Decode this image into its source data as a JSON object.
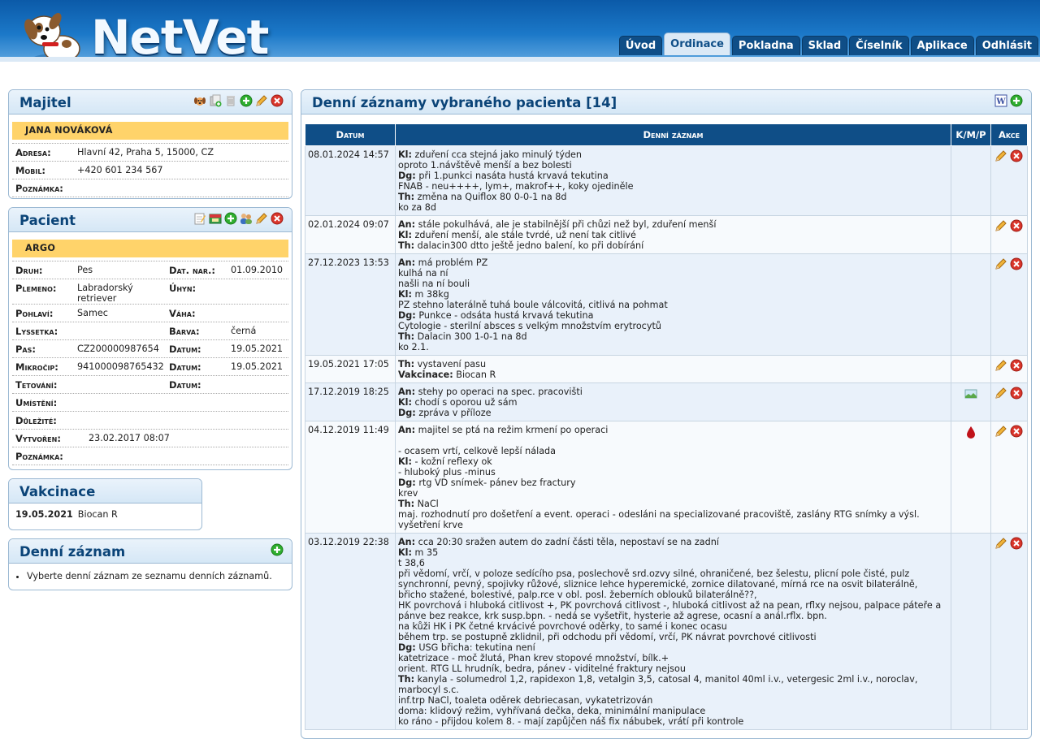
{
  "app": {
    "logo_text": "NetVet"
  },
  "tabs": [
    {
      "label": "Úvod",
      "active": false
    },
    {
      "label": "Ordinace",
      "active": true
    },
    {
      "label": "Pokladna",
      "active": false
    },
    {
      "label": "Sklad",
      "active": false
    },
    {
      "label": "Číselník",
      "active": false
    },
    {
      "label": "Aplikace",
      "active": false
    },
    {
      "label": "Odhlásit",
      "active": false
    }
  ],
  "owner": {
    "title": "Majitel",
    "name": "JANA NOVÁKOVÁ",
    "rows": [
      {
        "label": "Adresa:",
        "value": "Hlavní 42, Praha 5, 15000, CZ"
      },
      {
        "label": "Mobil:",
        "value": "+420 601 234 567"
      },
      {
        "label": "Poznámka:",
        "value": ""
      }
    ]
  },
  "patient": {
    "title": "Pacient",
    "name": "ARGO",
    "rows": [
      {
        "l1": "Druh:",
        "v1": "Pes",
        "l2": "Dat. nar.:",
        "v2": "01.09.2010"
      },
      {
        "l1": "Plemeno:",
        "v1": "Labradorský retriever",
        "l2": "Úhyn:",
        "v2": ""
      },
      {
        "l1": "Pohlaví:",
        "v1": "Samec",
        "l2": "Váha:",
        "v2": ""
      },
      {
        "l1": "Lyssetka:",
        "v1": "",
        "l2": "Barva:",
        "v2": "černá"
      },
      {
        "l1": "Pas:",
        "v1": "CZ200000987654",
        "l2": "Datum:",
        "v2": "19.05.2021"
      },
      {
        "l1": "Mikročip:",
        "v1": "941000098765432",
        "l2": "Datum:",
        "v2": "19.05.2021"
      },
      {
        "l1": "Tetování:",
        "v1": "",
        "l2": "Datum:",
        "v2": ""
      }
    ],
    "rows_single": [
      {
        "label": "Umístění:",
        "value": ""
      },
      {
        "label": "Důležité:",
        "value": ""
      },
      {
        "label": "Vytvořen:",
        "value": "23.02.2017 08:07"
      },
      {
        "label": "Poznámka:",
        "value": ""
      }
    ]
  },
  "vaccination": {
    "title": "Vakcinace",
    "date": "19.05.2021",
    "name": "Biocan R"
  },
  "daily_panel": {
    "title": "Denní záznam",
    "hint": "Vyberte denní záznam ze seznamu denních záznamů."
  },
  "records": {
    "title": "Denní záznamy vybraného pacienta [14]",
    "columns": {
      "date": "Datum",
      "record": "Denní záznam",
      "kmp": "K/M/P",
      "actions": "Akce"
    },
    "rows": [
      {
        "date": "08.01.2024 14:57",
        "kmp": "",
        "lines": [
          {
            "b": "Kl:",
            "t": " zduření cca stejná jako minulý týden"
          },
          {
            "b": "",
            "t": "oproto 1.návštěvě menší a bez bolesti"
          },
          {
            "b": "Dg:",
            "t": " při 1.punkci nasáta hustá krvavá tekutina"
          },
          {
            "b": "",
            "t": "FNAB - neu++++, lym+, makrof++, koky ojediněle"
          },
          {
            "b": "Th:",
            "t": " změna na Quiflox 80 0-0-1 na 8d"
          },
          {
            "b": "",
            "t": "ko za 8d"
          }
        ]
      },
      {
        "date": "02.01.2024 09:07",
        "kmp": "",
        "lines": [
          {
            "b": "An:",
            "t": " stále pokulhává, ale je stabilnější při chůzi než byl, zduření menší"
          },
          {
            "b": "Kl:",
            "t": " zduření menší, ale stále tvrdé, už není tak citlivé"
          },
          {
            "b": "Th:",
            "t": " dalacin300 dtto ještě jedno balení, ko při dobírání"
          }
        ]
      },
      {
        "date": "27.12.2023 13:53",
        "kmp": "",
        "lines": [
          {
            "b": "An:",
            "t": " má problém PZ"
          },
          {
            "b": "",
            "t": "kulhá na ní"
          },
          {
            "b": "",
            "t": "našli na ní bouli"
          },
          {
            "b": "Kl:",
            "t": " m 38kg"
          },
          {
            "b": "",
            "t": "PZ stehno laterálně tuhá boule válcovitá, citlivá na pohmat"
          },
          {
            "b": "Dg:",
            "t": " Punkce - odsáta hustá krvavá tekutina"
          },
          {
            "b": "",
            "t": "Cytologie - sterilní absces s velkým množstvím erytrocytů"
          },
          {
            "b": "Th:",
            "t": " Dalacin 300 1-0-1 na 8d"
          },
          {
            "b": "",
            "t": "ko 2.1."
          }
        ]
      },
      {
        "date": "19.05.2021 17:05",
        "kmp": "",
        "lines": [
          {
            "b": "Th:",
            "t": " vystavení pasu"
          },
          {
            "b": "Vakcinace:",
            "t": " Biocan R"
          }
        ]
      },
      {
        "date": "17.12.2019 18:25",
        "kmp": "image",
        "lines": [
          {
            "b": "An:",
            "t": " stehy po operaci na spec. pracovišti"
          },
          {
            "b": "Kl:",
            "t": " chodí s oporou už sám"
          },
          {
            "b": "Dg:",
            "t": " zpráva v příloze"
          }
        ]
      },
      {
        "date": "04.12.2019 11:49",
        "kmp": "blood",
        "lines": [
          {
            "b": "An:",
            "t": " majitel se ptá na režim krmení po operaci"
          },
          {
            "b": "",
            "t": " "
          },
          {
            "b": "",
            "t": "- ocasem vrtí, celkově lepší nálada"
          },
          {
            "b": "Kl:",
            "t": " - kožní reflexy ok"
          },
          {
            "b": "",
            "t": "- hluboký plus -minus"
          },
          {
            "b": "Dg:",
            "t": " rtg VD snímek- pánev bez fractury"
          },
          {
            "b": "",
            "t": "krev"
          },
          {
            "b": "Th:",
            "t": " NaCl"
          },
          {
            "b": "",
            "t": "maj. rozhodnutí pro došetření a event. operaci - odesláni na specializované pracoviště, zaslány RTG snímky a výsl."
          },
          {
            "b": "",
            "t": "vyšetření krve"
          }
        ]
      },
      {
        "date": "03.12.2019 22:38",
        "kmp": "",
        "lines": [
          {
            "b": "An:",
            "t": " cca 20:30 sražen autem do zadní části těla, nepostaví se na zadní"
          },
          {
            "b": "Kl:",
            "t": " m 35"
          },
          {
            "b": "",
            "t": "t 38,6"
          },
          {
            "b": "",
            "t": "při vědomí, vrčí, v poloze sedícího psa, poslechově srd.ozvy silné, ohraničené, bez šelestu, plicní pole čisté, pulz synchronní, pevný, spojivky růžové, sliznice lehce hyperemické, zornice dilatované, mírná rce na osvit bilaterálně, břicho stažené, bolestivé, palp.rce v obl. posl. žeberních oblouků bilaterálně??,"
          },
          {
            "b": "",
            "t": "HK povrchová i hluboká citlivost +, PK povrchová citlivost -, hluboká citlivost až na pean, rflxy nejsou, palpace páteře a pánve bez reakce, krk susp.bpn. - nedá se vyšetřit, hysterie až agrese, ocasní a anál.rflx. bpn."
          },
          {
            "b": "",
            "t": "na kůži HK i PK četné krvácivé povrchové oděrky, to samé i konec ocasu"
          },
          {
            "b": "",
            "t": "během trp. se postupně zklidnil, při odchodu při vědomí, vrčí, PK návrat povrchové citlivosti"
          },
          {
            "b": "Dg:",
            "t": " USG břicha: tekutina není"
          },
          {
            "b": "",
            "t": "katetrizace - moč žlutá, Phan krev stopové množství, bílk.+"
          },
          {
            "b": "",
            "t": "orient. RTG LL hrudník, bedra, pánev - viditelné fraktury nejsou"
          },
          {
            "b": "Th:",
            "t": " kanyla - solumedrol 1,2, rapidexon 1,8, vetalgin 3,5, catosal 4, manitol 40ml i.v., vetergesic 2ml i.v., noroclav, marbocyl s.c."
          },
          {
            "b": "",
            "t": "inf.trp NaCl, toaleta oděrek debriecasan, vykatetrizován"
          },
          {
            "b": "",
            "t": "doma: klidový režim, vyhřívaná dečka, deka, minimální manipulace"
          },
          {
            "b": "",
            "t": "ko ráno - přijdou kolem 8. - mají zapůjčen náš fix nábubek, vrátí při kontrole"
          }
        ]
      }
    ]
  }
}
